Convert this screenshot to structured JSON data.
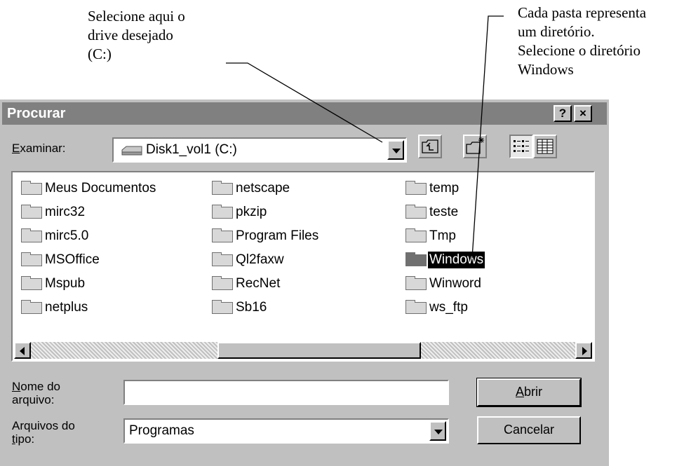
{
  "annotations": {
    "drive_note": "Selecione aqui o\ndrive desejado\n(C:)",
    "folder_note": "Cada pasta representa\num diretório.\nSelecione o diretório\nWindows"
  },
  "dialog": {
    "title": "Procurar",
    "help_label": "?",
    "close_label": "×",
    "look_in": {
      "label_underlined": "E",
      "label_rest": "xaminar:",
      "value": "Disk1_vol1 (C:)"
    },
    "toolbar": [
      "up-one-level-icon",
      "new-folder-icon",
      "list-view-icon",
      "details-view-icon"
    ],
    "files": [
      {
        "name": "Meus Documentos"
      },
      {
        "name": "mirc32"
      },
      {
        "name": "mirc5.0"
      },
      {
        "name": "MSOffice"
      },
      {
        "name": "Mspub"
      },
      {
        "name": "netplus"
      },
      {
        "name": "netscape"
      },
      {
        "name": "pkzip"
      },
      {
        "name": "Program Files"
      },
      {
        "name": "Ql2faxw"
      },
      {
        "name": "RecNet"
      },
      {
        "name": "Sb16"
      },
      {
        "name": "temp"
      },
      {
        "name": "teste"
      },
      {
        "name": "Tmp"
      },
      {
        "name": "Windows",
        "selected": true
      },
      {
        "name": "Winword"
      },
      {
        "name": "ws_ftp"
      }
    ],
    "filename": {
      "label_underlined": "N",
      "label_line1_rest": "ome do",
      "label_line2": "arquivo:",
      "value": ""
    },
    "filetype": {
      "label_line1": "Arquivos do",
      "label_underlined": "t",
      "label_line2_rest": "ipo:",
      "value": "Programas"
    },
    "open_underlined": "A",
    "open_rest": "brir",
    "cancel_label": "Cancelar"
  },
  "colors": {
    "title_bar": "#808080",
    "dialog_face": "#c0c0c0",
    "selection": "#000000"
  }
}
